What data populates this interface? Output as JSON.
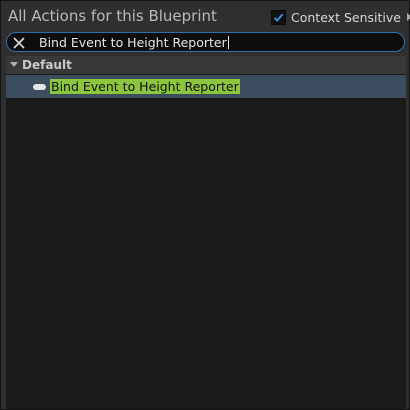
{
  "header": {
    "title": "All Actions for this Blueprint",
    "context_sensitive_label": "Context Sensitive",
    "context_sensitive_checked": true
  },
  "search": {
    "value": "Bind Event to Height Reporter",
    "clear_icon": "close-icon"
  },
  "list": {
    "category": "Default",
    "items": [
      {
        "label": "Bind Event to Height Reporter",
        "icon": "event-pill-icon",
        "selected": true
      }
    ]
  },
  "colors": {
    "highlight": "#8cc63f",
    "selected_row": "#3c4d5d",
    "accent": "#2f6fa8"
  }
}
